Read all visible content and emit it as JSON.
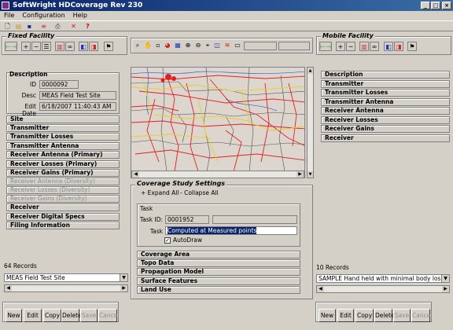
{
  "window": {
    "title": "SoftWright HDCoverage Rev 230"
  },
  "menu": [
    "File",
    "Configuration",
    "Help"
  ],
  "fixed_facility": {
    "title": "Fixed Facility",
    "description_header": "Description",
    "id_label": "ID",
    "id_value": "0000092",
    "desc_label": "Desc",
    "desc_value": "MEAS Field Test Site",
    "edit_label": "Edit Date",
    "edit_value": "6/18/2007 11:40:43 AM",
    "sections": [
      {
        "label": "Site",
        "enabled": true
      },
      {
        "label": "Transmitter",
        "enabled": true
      },
      {
        "label": "Transmitter Losses",
        "enabled": true
      },
      {
        "label": "Transmitter Antenna",
        "enabled": true
      },
      {
        "label": "Receiver Antenna (Primary)",
        "enabled": true
      },
      {
        "label": "Receiver Losses (Primary)",
        "enabled": true
      },
      {
        "label": "Receiver Gains (Primary)",
        "enabled": true
      },
      {
        "label": "Receiver Antenna (Diversity)",
        "enabled": false
      },
      {
        "label": "Receiver Losses (Diversity)",
        "enabled": false
      },
      {
        "label": "Receiver Gains (Diversity)",
        "enabled": false
      },
      {
        "label": "Receiver",
        "enabled": true
      },
      {
        "label": "Receiver Digital Specs",
        "enabled": true
      },
      {
        "label": "Filing Information",
        "enabled": true
      }
    ],
    "records": "64 Records",
    "selected": "MEAS Field Test Site"
  },
  "mobile_facility": {
    "title": "Mobile Facility",
    "sections": [
      "Description",
      "Transmitter",
      "Transmitter Losses",
      "Transmitter Antenna",
      "Receiver Antenna",
      "Receiver Losses",
      "Receiver Gains",
      "Receiver"
    ],
    "records": "10 Records",
    "selected": "SAMPLE Hand held with minimal body losse"
  },
  "study": {
    "title": "Coverage Study Settings",
    "expand_all": "+ Expand All",
    "collapse_all": "- Collapse All",
    "task_header": "Task",
    "task_id_label": "Task ID:",
    "task_id_value": "0001952",
    "task_label": "Task",
    "task_value": "Computed at Measured points",
    "autodraw_label": "AutoDraw",
    "sections": [
      "Coverage Area",
      "Topo Data",
      "Propagation Model",
      "Surface Features",
      "Land Use"
    ]
  },
  "buttons": {
    "new": "New",
    "edit": "Edit",
    "copy": "Copy",
    "delete": "Delete",
    "save": "Save",
    "cancel": "Cancel"
  },
  "colors": {
    "titlebar": "#0a246a",
    "road_red": "#e02020",
    "road_yellow": "#e8d020",
    "water_blue": "#3060d0",
    "border_gray": "#505050"
  }
}
